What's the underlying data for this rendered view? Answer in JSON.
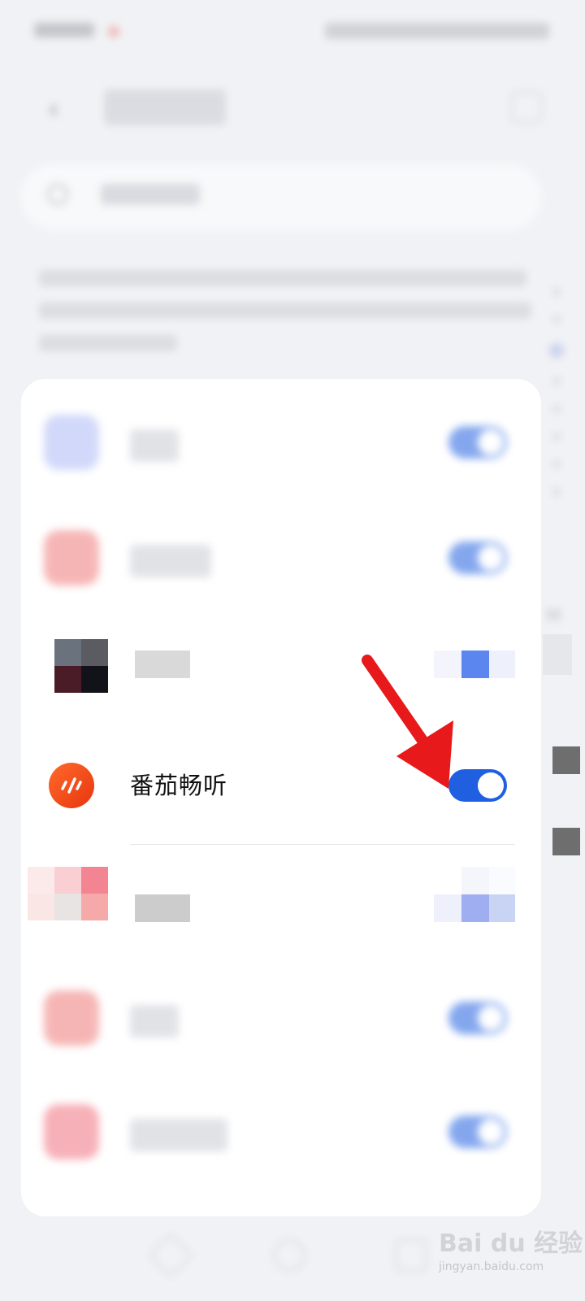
{
  "status_bar": {
    "time": "",
    "signal": ""
  },
  "app_bar": {
    "back_label": "‹",
    "title": ""
  },
  "search": {
    "placeholder": ""
  },
  "description_lines": [
    "",
    "",
    ""
  ],
  "index_bar": {
    "letter": "M"
  },
  "list": [
    {
      "name": "",
      "enabled": true,
      "icon_color": "#7f93f0",
      "blurred": true
    },
    {
      "name": "",
      "enabled": true,
      "icon_color": "#f07a7a",
      "blurred": true
    },
    {
      "name": "",
      "enabled": true,
      "icon_color": "#5a5d63",
      "pixelated": true
    },
    {
      "name": "番茄畅听",
      "enabled": true,
      "icon_color": "#f04a1a",
      "focus": true
    },
    {
      "name": "",
      "enabled": true,
      "icon_color": "#f39aa0",
      "pixelated": true
    },
    {
      "name": "",
      "enabled": true,
      "icon_color": "#f07a7a",
      "blurred": true
    },
    {
      "name": "",
      "enabled": true,
      "icon_color": "#f0707e",
      "blurred": true
    }
  ],
  "colors": {
    "toggle_on": "#1f5fe0",
    "arrow": "#e8191b",
    "background": "#f1f2f5"
  },
  "watermark": {
    "logo": "Bai du 经验",
    "url": "jingyan.baidu.com"
  }
}
